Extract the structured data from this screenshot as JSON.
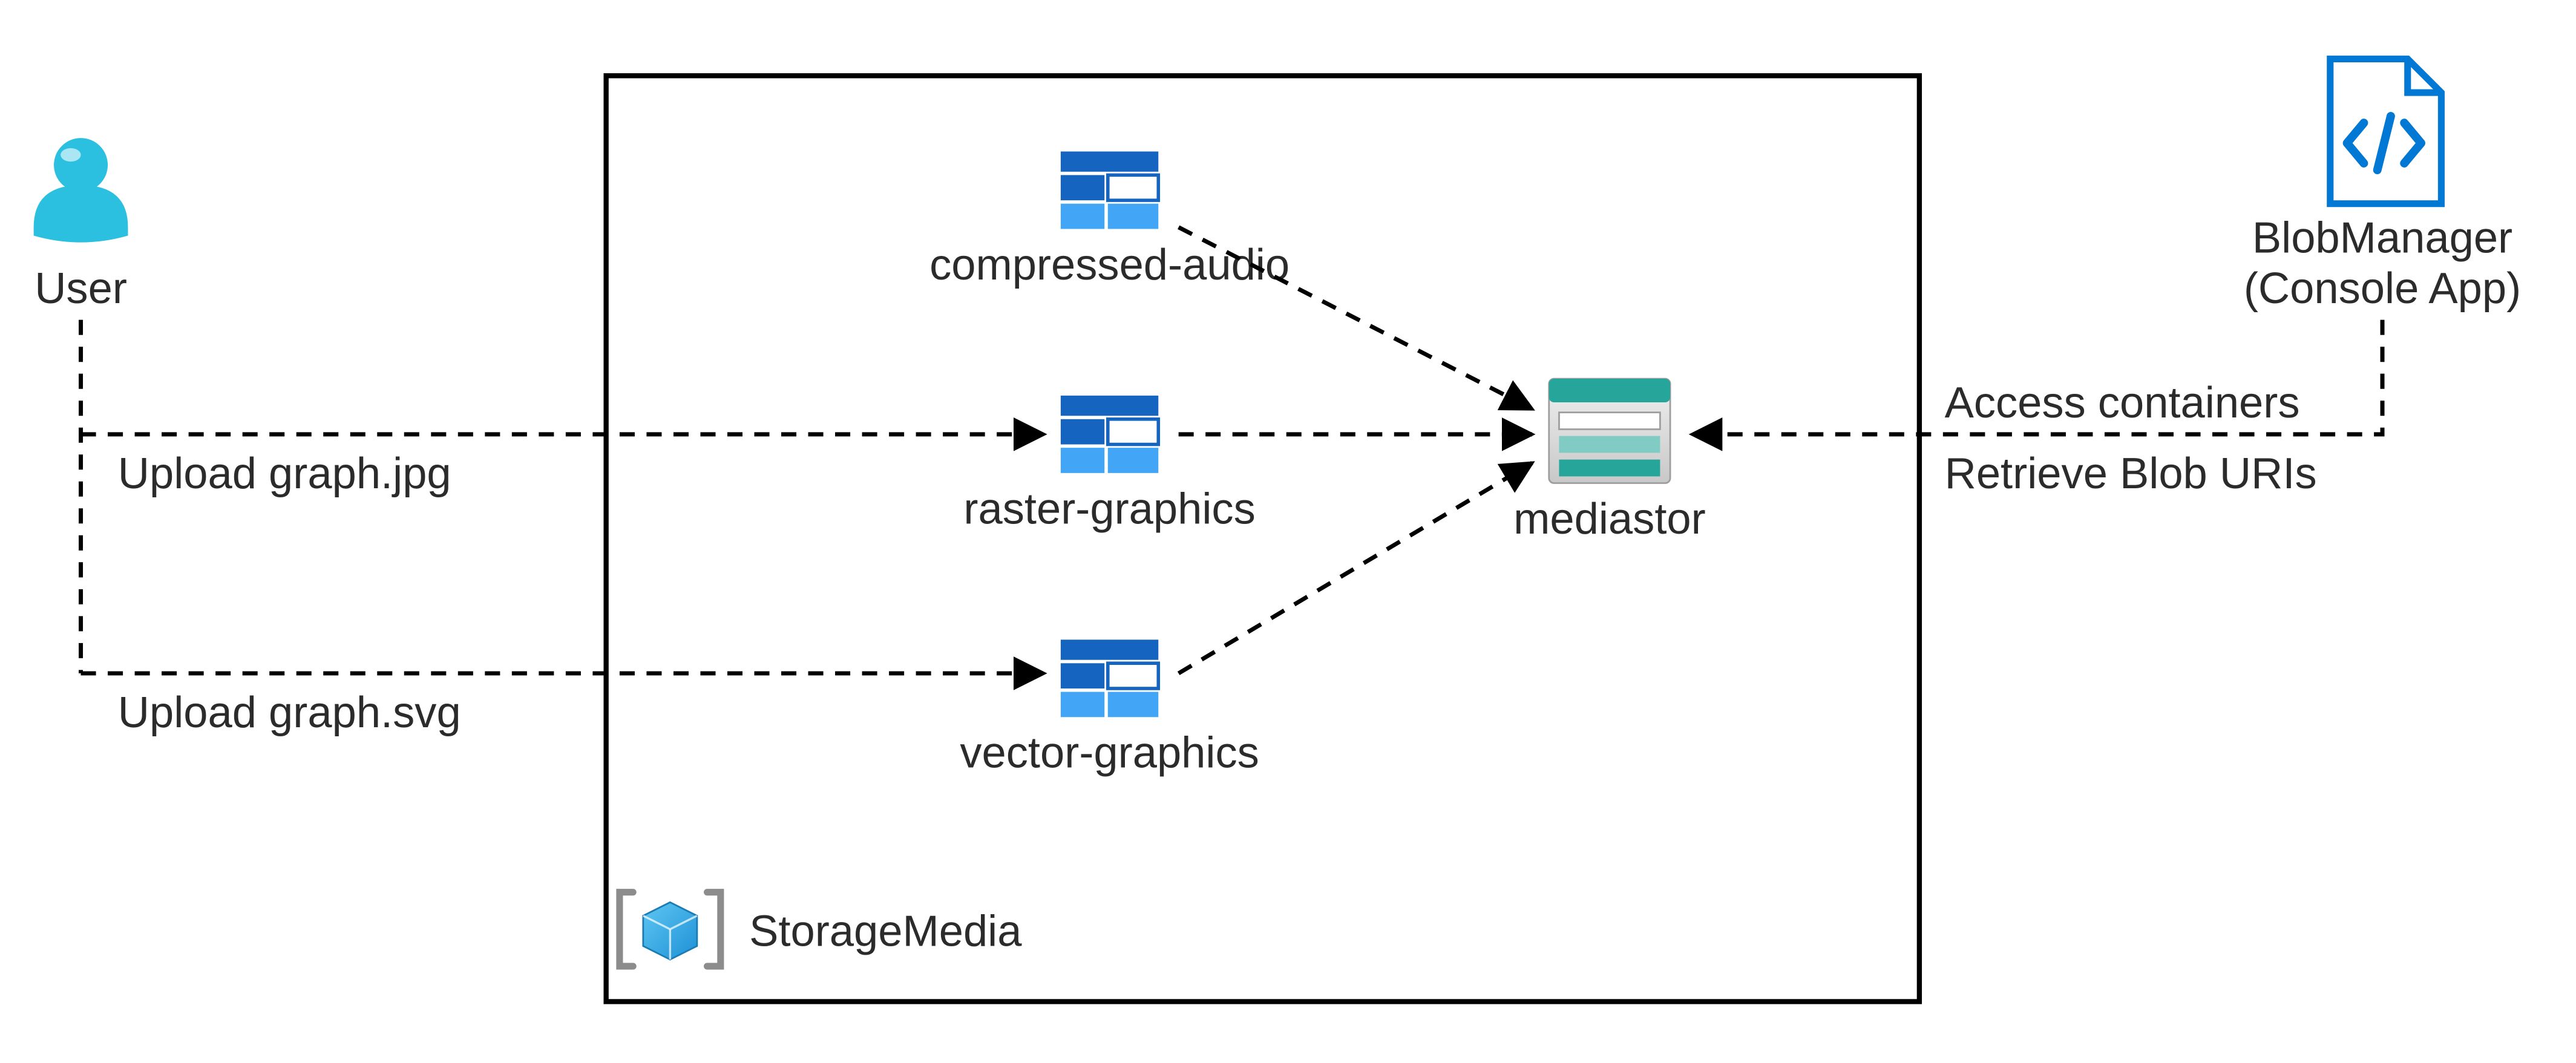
{
  "actors": {
    "user": {
      "label": "User"
    },
    "blobmanager": {
      "line1": "BlobManager",
      "line2": "(Console App)"
    }
  },
  "resourceGroup": {
    "label": "StorageMedia"
  },
  "containers": {
    "compressedAudio": {
      "label": "compressed-audio"
    },
    "rasterGraphics": {
      "label": "raster-graphics"
    },
    "vectorGraphics": {
      "label": "vector-graphics"
    }
  },
  "storageAccount": {
    "label": "mediastor"
  },
  "edges": {
    "uploadJpg": "Upload graph.jpg",
    "uploadSvg": "Upload graph.svg",
    "accessContainers": "Access containers",
    "retrieveBlobUris": "Retrieve Blob URIs"
  },
  "colors": {
    "azureBlue": "#0078D4",
    "userTeal": "#2CC0E0",
    "containerDark": "#1565C0",
    "containerLight": "#42A5F5",
    "storageTealDark": "#26A69A",
    "storageTealLight": "#80CBC4"
  }
}
